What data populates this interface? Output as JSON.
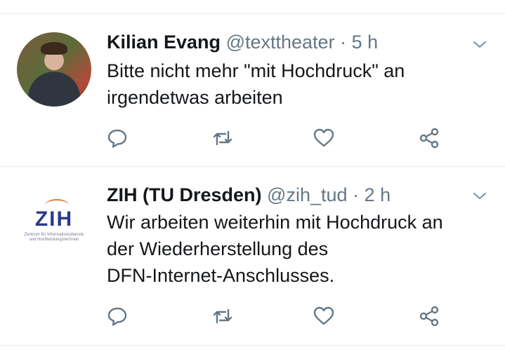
{
  "tweets": [
    {
      "name": "Kilian Evang",
      "handle": "@texttheater",
      "separator": "·",
      "time": "5 h",
      "lines": [
        "Bitte nicht mehr \"mit Hochdruck\" an",
        "irgendetwas arbeiten"
      ],
      "avatar": "person-photo"
    },
    {
      "name": "ZIH (TU Dresden)",
      "handle": "@zih_tud",
      "separator": "·",
      "time": "2 h",
      "lines": [
        "Wir arbeiten weiterhin mit Hochdruck an",
        "der Wiederherstellung des",
        "DFN-Internet-Anschlusses."
      ],
      "avatar": "zih-logo",
      "logo": {
        "text": "ZIH",
        "subtitle_1": "Zentrum für Informationsdienste",
        "subtitle_2": "und Hochleistungsrechnen"
      }
    }
  ],
  "icons": [
    "reply-icon",
    "retweet-icon",
    "like-icon",
    "share-icon",
    "chevron-down-icon"
  ],
  "colors": {
    "text": "#14171a",
    "secondary": "#657786",
    "divider": "#e6ecf0",
    "logo_blue": "#2b3a8c",
    "logo_orange": "#e07a2a"
  }
}
